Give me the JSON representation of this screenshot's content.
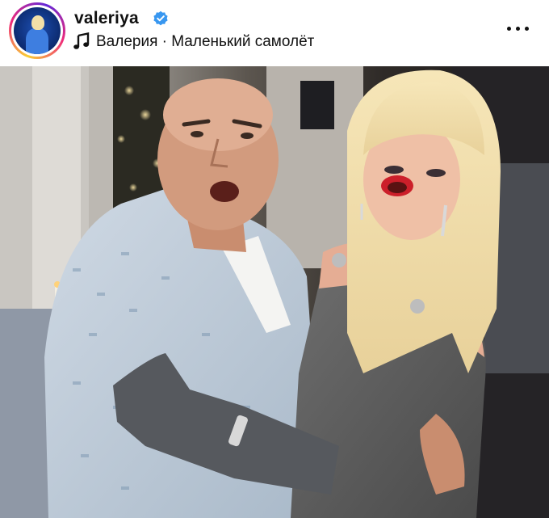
{
  "post": {
    "username": "valeriya",
    "verified": true,
    "audio": "Валерия · Маленький самолёт",
    "more_icon": "more-horizontal-icon",
    "music_icon": "music-note-icon",
    "verified_icon": "verified-badge-icon"
  },
  "colors": {
    "verified_blue": "#3897f0",
    "text": "#111111",
    "story_ring": [
      "#f9ce34",
      "#ee2a7b",
      "#6228d7"
    ]
  }
}
